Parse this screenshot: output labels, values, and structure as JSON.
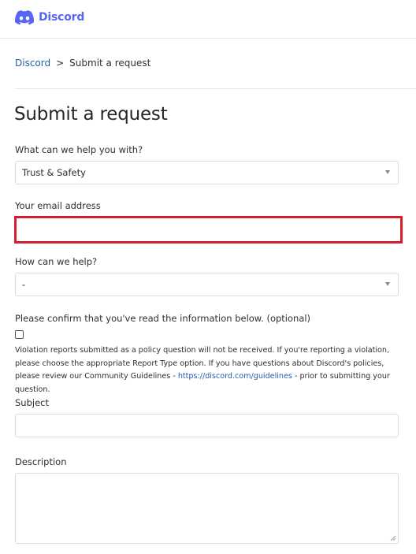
{
  "header": {
    "logo_text": "Discord",
    "brand_color": "#5865f2",
    "logo_icon": "discord-logo-icon"
  },
  "breadcrumb": {
    "home": "Discord",
    "separator": ">",
    "current": "Submit a request"
  },
  "page_title": "Submit a request",
  "form": {
    "request_type": {
      "label": "What can we help you with?",
      "value": "Trust & Safety"
    },
    "email": {
      "label": "Your email address",
      "value": "",
      "highlight_color": "#d61f2b"
    },
    "help_type": {
      "label": "How can we help?",
      "value": "-"
    },
    "confirm": {
      "label": "Please confirm that you've read the information below. (optional)",
      "checked": false,
      "description_before_link": "Violation reports submitted as a policy question will not be received. If you're reporting a violation, please choose the appropriate Report Type option. If you have questions about Discord's policies, please review our Community Guidelines - ",
      "link_text": "https://discord.com/guidelines",
      "description_after_link": " - prior to submitting your question."
    },
    "subject": {
      "label": "Subject",
      "value": ""
    },
    "description": {
      "label": "Description",
      "value": ""
    }
  }
}
